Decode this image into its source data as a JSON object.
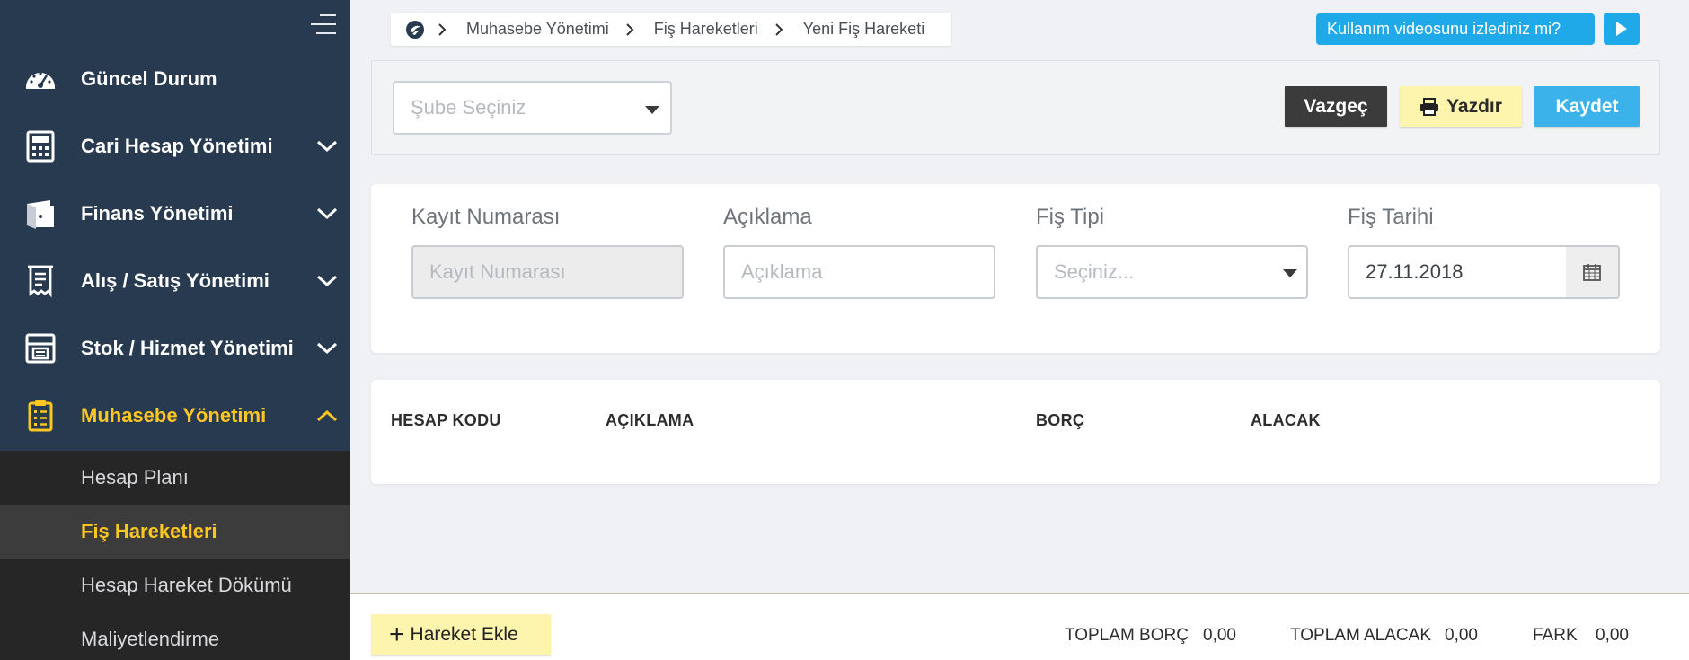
{
  "sidebar": {
    "items": [
      {
        "label": "Güncel Durum",
        "icon": "speedometer-icon",
        "has_chevron": false
      },
      {
        "label": "Cari Hesap Yönetimi",
        "icon": "calculator-icon",
        "has_chevron": true
      },
      {
        "label": "Finans Yönetimi",
        "icon": "wallet-icon",
        "has_chevron": true
      },
      {
        "label": "Alış / Satış Yönetimi",
        "icon": "receipt-icon",
        "has_chevron": true
      },
      {
        "label": "Stok / Hizmet Yönetimi",
        "icon": "printer-box-icon",
        "has_chevron": true
      },
      {
        "label": "Muhasebe Yönetimi",
        "icon": "clipboard-icon",
        "has_chevron": true
      }
    ],
    "submenu": [
      {
        "label": "Hesap Planı"
      },
      {
        "label": "Fiş Hareketleri"
      },
      {
        "label": "Hesap Hareket Dökümü"
      },
      {
        "label": "Maliyetlendirme"
      }
    ]
  },
  "breadcrumb": {
    "items": [
      "Muhasebe Yönetimi",
      "Fiş Hareketleri",
      "Yeni Fiş Hareketi"
    ]
  },
  "help": {
    "video_label": "Kullanım videosunu izlediniz mi?"
  },
  "toolbar": {
    "branch_placeholder": "Şube Seçiniz",
    "cancel_label": "Vazgeç",
    "print_label": "Yazdır",
    "save_label": "Kaydet"
  },
  "form": {
    "record_no_label": "Kayıt Numarası",
    "record_no_placeholder": "Kayıt Numarası",
    "description_label": "Açıklama",
    "description_placeholder": "Açıklama",
    "type_label": "Fiş Tipi",
    "type_placeholder": "Seçiniz...",
    "date_label": "Fiş Tarihi",
    "date_value": "27.11.2018"
  },
  "table": {
    "columns": [
      "HESAP KODU",
      "AÇIKLAMA",
      "BORÇ",
      "ALACAK"
    ]
  },
  "footer": {
    "add_label": "Hareket Ekle",
    "total_debit_label": "TOPLAM BORÇ",
    "total_debit_value": "0,00",
    "total_credit_label": "TOPLAM ALACAK",
    "total_credit_value": "0,00",
    "diff_label": "FARK",
    "diff_value": "0,00"
  },
  "colors": {
    "sidebar_bg": "#283a4f",
    "accent_yellow": "#fdc623",
    "accent_blue": "#1fa9e8",
    "submenu_bg": "#262626"
  }
}
